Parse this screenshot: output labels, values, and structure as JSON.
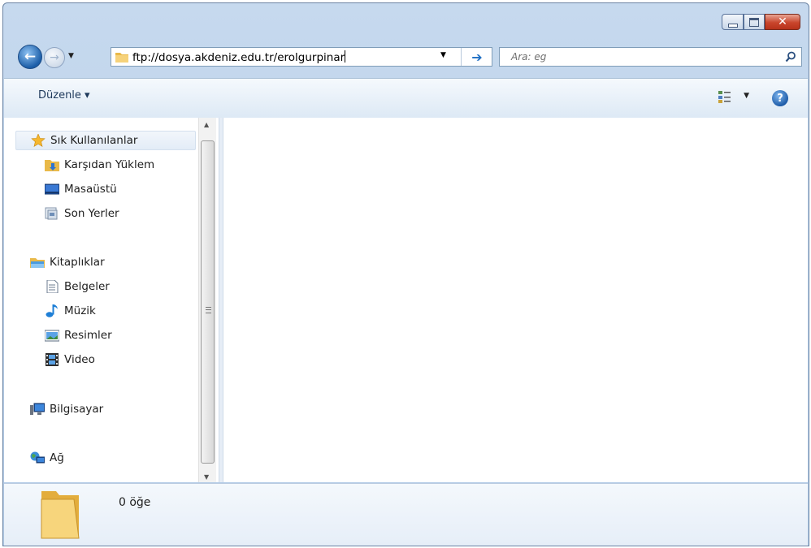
{
  "window": {
    "minimize_label": "–",
    "close_label": "✕"
  },
  "navigation": {
    "back_icon": "back-arrow-icon",
    "forward_icon": "forward-arrow-icon",
    "address": "ftp://dosya.akdeniz.edu.tr/erolgurpinar",
    "go_icon": "arrow-right-icon",
    "search_placeholder": "Ara: eg"
  },
  "toolbar": {
    "organize_label": "Düzenle ▾",
    "help_label": "?"
  },
  "sidebar": {
    "favorites": {
      "label": "Sık Kullanılanlar",
      "icon": "star-icon",
      "items": [
        {
          "label": "Karşıdan Yüklem",
          "icon": "downloads-icon"
        },
        {
          "label": "Masaüstü",
          "icon": "desktop-icon"
        },
        {
          "label": "Son Yerler",
          "icon": "recent-places-icon"
        }
      ]
    },
    "libraries": {
      "label": "Kitaplıklar",
      "icon": "library-icon",
      "items": [
        {
          "label": "Belgeler",
          "icon": "document-icon"
        },
        {
          "label": "Müzik",
          "icon": "music-icon"
        },
        {
          "label": "Resimler",
          "icon": "pictures-icon"
        },
        {
          "label": "Video",
          "icon": "video-icon"
        }
      ]
    },
    "computer": {
      "label": "Bilgisayar",
      "icon": "computer-icon"
    },
    "network": {
      "label": "Ağ",
      "icon": "network-icon"
    }
  },
  "details": {
    "item_count": "0 öğe"
  },
  "colors": {
    "frame": "#b3cbe6",
    "accent": "#1f6fc4",
    "close": "#c9452c"
  }
}
